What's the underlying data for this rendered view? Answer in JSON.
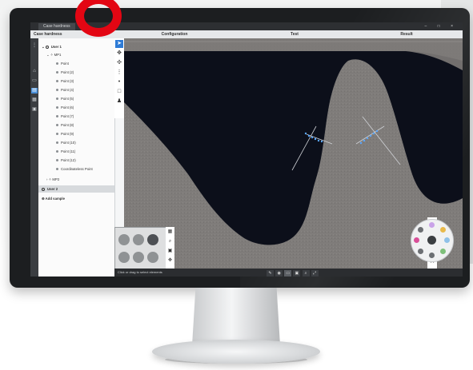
{
  "window": {
    "tab_title": "Case hardness",
    "controls": "– □ ×"
  },
  "header": {
    "panel_title": "Case hardness",
    "steps": [
      "Configuration",
      "Test",
      "Result"
    ]
  },
  "rail_icons": [
    "grid-icon",
    "home-icon",
    "image-icon",
    "document-icon",
    "report-icon",
    "camera-icon"
  ],
  "tree": {
    "user1": "User 1",
    "mp1": "MP1",
    "points": [
      "Point",
      "Point (2)",
      "Point (3)",
      "Point (4)",
      "Point (5)",
      "Point (6)",
      "Point (7)",
      "Point (8)",
      "Point (9)",
      "Point (10)",
      "Point (11)",
      "Point (12)"
    ],
    "cht_point": "Coordinateless Point",
    "mp2": "MP2",
    "user2": "User 2",
    "add_sample": "Add sample"
  },
  "toolbar": [
    "select-arrow-icon",
    "move-icon",
    "crosshair-icon",
    "grid-icon",
    "point-icon",
    "square-icon",
    "person-icon"
  ],
  "statusbar": {
    "message": "Click or drag to select elements"
  },
  "colors": {
    "accent": "#2e7bd6",
    "brand_red": "#e30613",
    "sample_gray": "#7d7a78",
    "viewport_bg": "#0c0f1a"
  }
}
